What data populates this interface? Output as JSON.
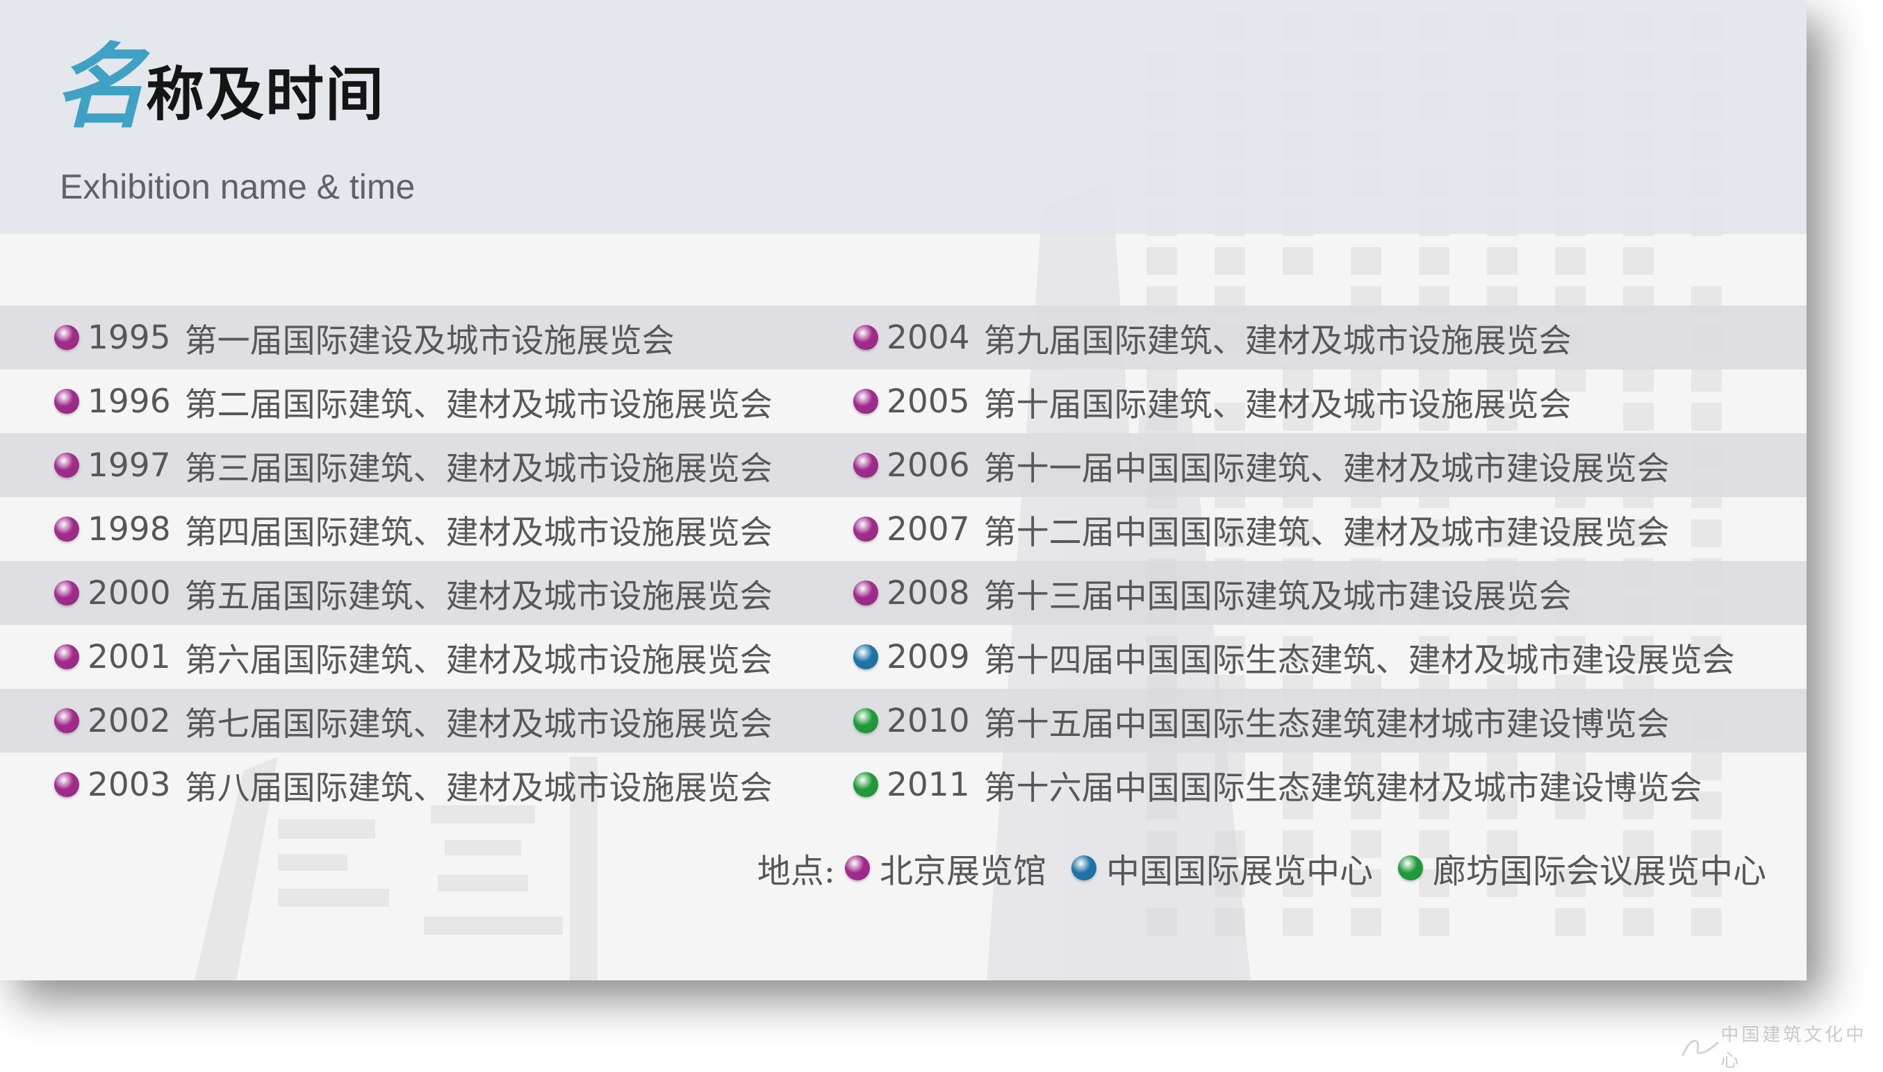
{
  "title": {
    "first_char": "名",
    "rest": "称及时间"
  },
  "subtitle": "Exhibition name & time",
  "colors": {
    "purple": "#a02a8a",
    "blue": "#1f74a6",
    "green": "#1f9a3a",
    "title_accent": "#3fa2c4"
  },
  "left_column": [
    {
      "year": "1995",
      "name": "第一届国际建设及城市设施展览会",
      "color": "purple"
    },
    {
      "year": "1996",
      "name": "第二届国际建筑、建材及城市设施展览会",
      "color": "purple"
    },
    {
      "year": "1997",
      "name": "第三届国际建筑、建材及城市设施展览会",
      "color": "purple"
    },
    {
      "year": "1998",
      "name": "第四届国际建筑、建材及城市设施展览会",
      "color": "purple"
    },
    {
      "year": "2000",
      "name": "第五届国际建筑、建材及城市设施展览会",
      "color": "purple"
    },
    {
      "year": "2001",
      "name": "第六届国际建筑、建材及城市设施展览会",
      "color": "purple"
    },
    {
      "year": "2002",
      "name": "第七届国际建筑、建材及城市设施展览会",
      "color": "purple"
    },
    {
      "year": "2003",
      "name": "第八届国际建筑、建材及城市设施展览会",
      "color": "purple"
    }
  ],
  "right_column": [
    {
      "year": "2004",
      "name": "第九届国际建筑、建材及城市设施展览会",
      "color": "purple"
    },
    {
      "year": "2005",
      "name": "第十届国际建筑、建材及城市设施展览会",
      "color": "purple"
    },
    {
      "year": "2006",
      "name": "第十一届中国国际建筑、建材及城市建设展览会",
      "color": "purple"
    },
    {
      "year": "2007",
      "name": "第十二届中国国际建筑、建材及城市建设展览会",
      "color": "purple"
    },
    {
      "year": "2008",
      "name": "第十三届中国国际建筑及城市建设展览会",
      "color": "purple"
    },
    {
      "year": "2009",
      "name": "第十四届中国国际生态建筑、建材及城市建设展览会",
      "color": "blue"
    },
    {
      "year": "2010",
      "name": "第十五届中国国际生态建筑建材城市建设博览会",
      "color": "green"
    },
    {
      "year": "2011",
      "name": "第十六届中国国际生态建筑建材及城市建设博览会",
      "color": "green"
    }
  ],
  "location": {
    "label": "地点:",
    "items": [
      {
        "name": "北京展览馆",
        "color": "purple"
      },
      {
        "name": "中国国际展览中心",
        "color": "blue"
      },
      {
        "name": "廊坊国际会议展览中心",
        "color": "green"
      }
    ]
  },
  "watermark": {
    "text": "中国建筑文化中心"
  }
}
